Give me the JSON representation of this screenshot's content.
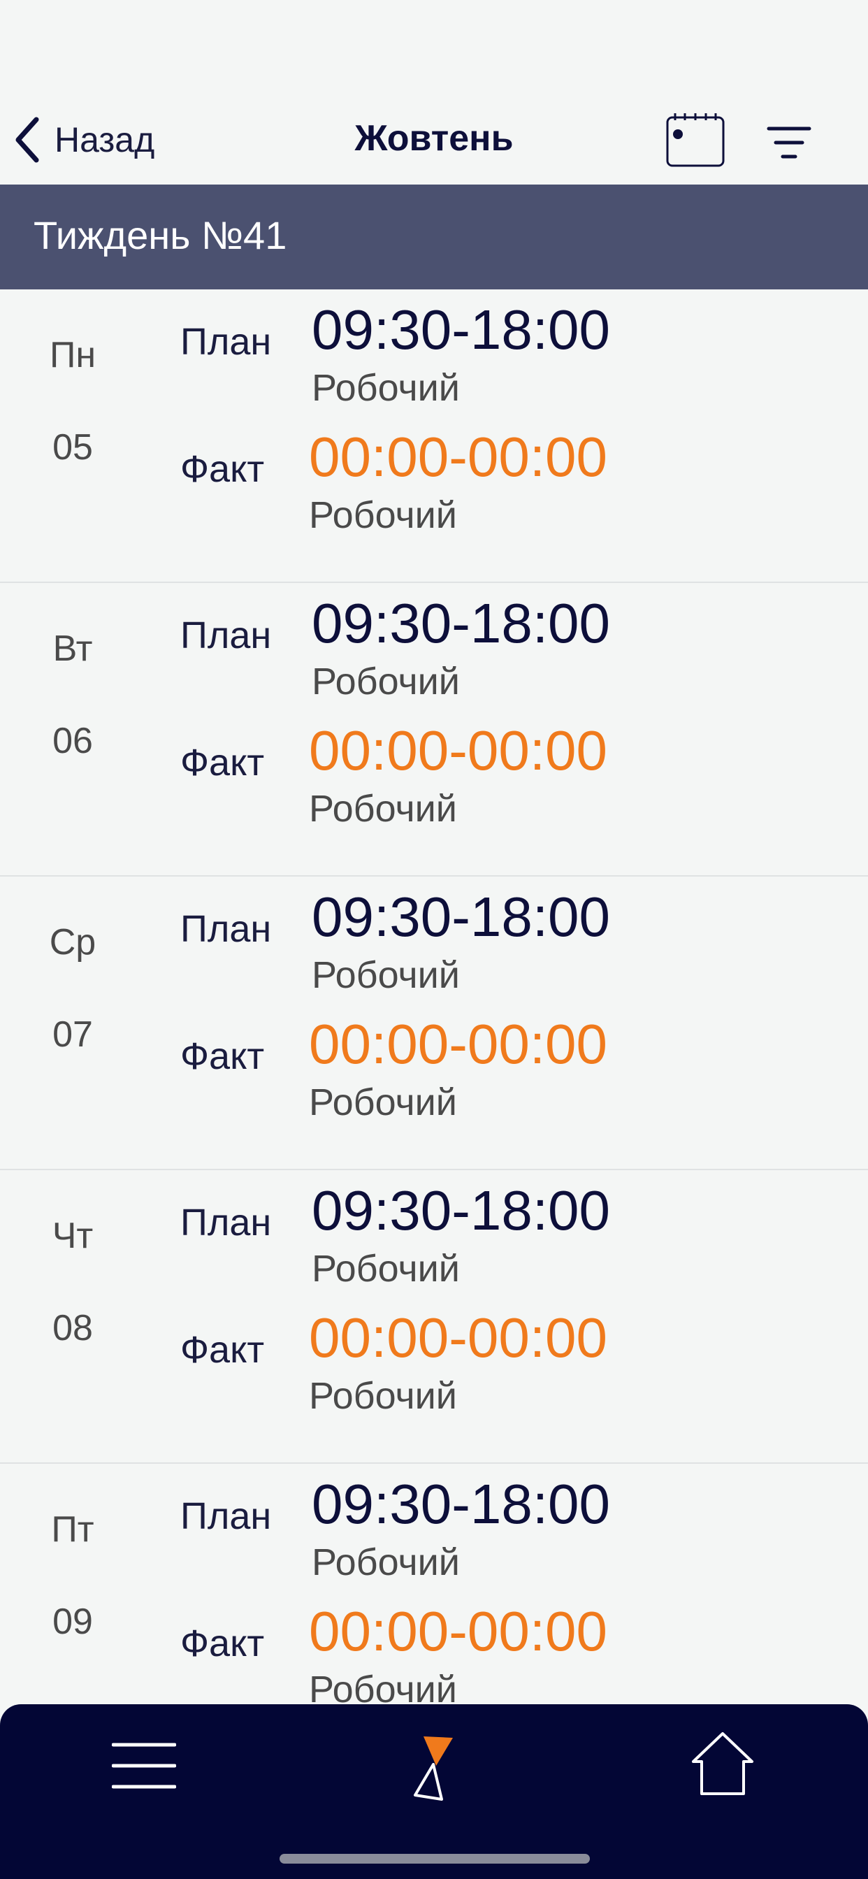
{
  "header": {
    "back_label": "Назад",
    "title": "Жовтень",
    "calendar_icon": "calendar-icon",
    "filter_icon": "filter-icon"
  },
  "week": {
    "label": "Тиждень №41"
  },
  "days": [
    {
      "name": "Пн",
      "num": "05",
      "plan_label": "План",
      "plan_time": "09:30-18:00",
      "plan_type": "Робочий",
      "fact_label": "Факт",
      "fact_time": "00:00-00:00",
      "fact_type": "Робочий"
    },
    {
      "name": "Вт",
      "num": "06",
      "plan_label": "План",
      "plan_time": "09:30-18:00",
      "plan_type": "Робочий",
      "fact_label": "Факт",
      "fact_time": "00:00-00:00",
      "fact_type": "Робочий"
    },
    {
      "name": "Ср",
      "num": "07",
      "plan_label": "План",
      "plan_time": "09:30-18:00",
      "plan_type": "Робочий",
      "fact_label": "Факт",
      "fact_time": "00:00-00:00",
      "fact_type": "Робочий"
    },
    {
      "name": "Чт",
      "num": "08",
      "plan_label": "План",
      "plan_time": "09:30-18:00",
      "plan_type": "Робочий",
      "fact_label": "Факт",
      "fact_time": "00:00-00:00",
      "fact_type": "Робочий"
    },
    {
      "name": "Пт",
      "num": "09",
      "plan_label": "План",
      "plan_time": "09:30-18:00",
      "plan_type": "Робочий",
      "fact_label": "Факт",
      "fact_time": "00:00-00:00",
      "fact_type": "Робочий"
    }
  ],
  "tab_bar": {
    "menu_icon": "menu-icon",
    "logo_icon": "app-logo-icon",
    "home_icon": "home-icon"
  },
  "colors": {
    "accent": "#f07a1c",
    "week_bar": "#4b5170",
    "tab_bar": "#030635",
    "text_dark": "#0d0f3a"
  }
}
